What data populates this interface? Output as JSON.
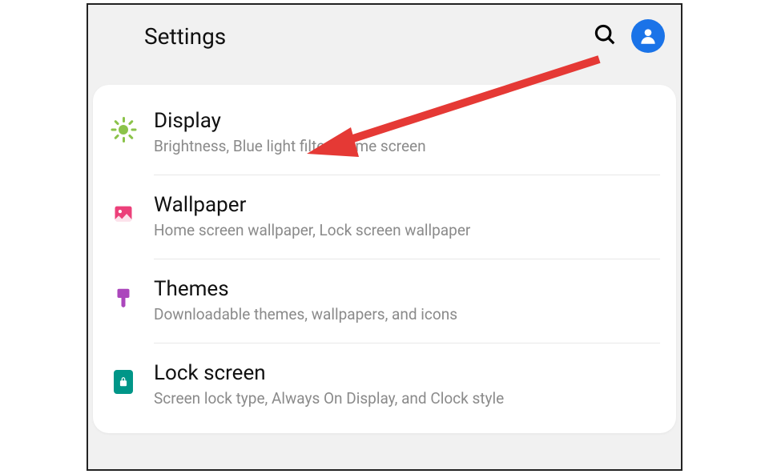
{
  "header": {
    "title": "Settings"
  },
  "items": [
    {
      "title": "Display",
      "subtitle": "Brightness, Blue light filter, Home screen"
    },
    {
      "title": "Wallpaper",
      "subtitle": "Home screen wallpaper, Lock screen wallpaper"
    },
    {
      "title": "Themes",
      "subtitle": "Downloadable themes, wallpapers, and icons"
    },
    {
      "title": "Lock screen",
      "subtitle": "Screen lock type, Always On Display, and Clock style"
    }
  ],
  "colors": {
    "accent_blue": "#1a73e8",
    "display_green": "#8bc34a",
    "wallpaper_pink": "#ec407a",
    "themes_purple": "#ab47bc",
    "lock_teal": "#009688",
    "annotation_red": "#e53935"
  }
}
